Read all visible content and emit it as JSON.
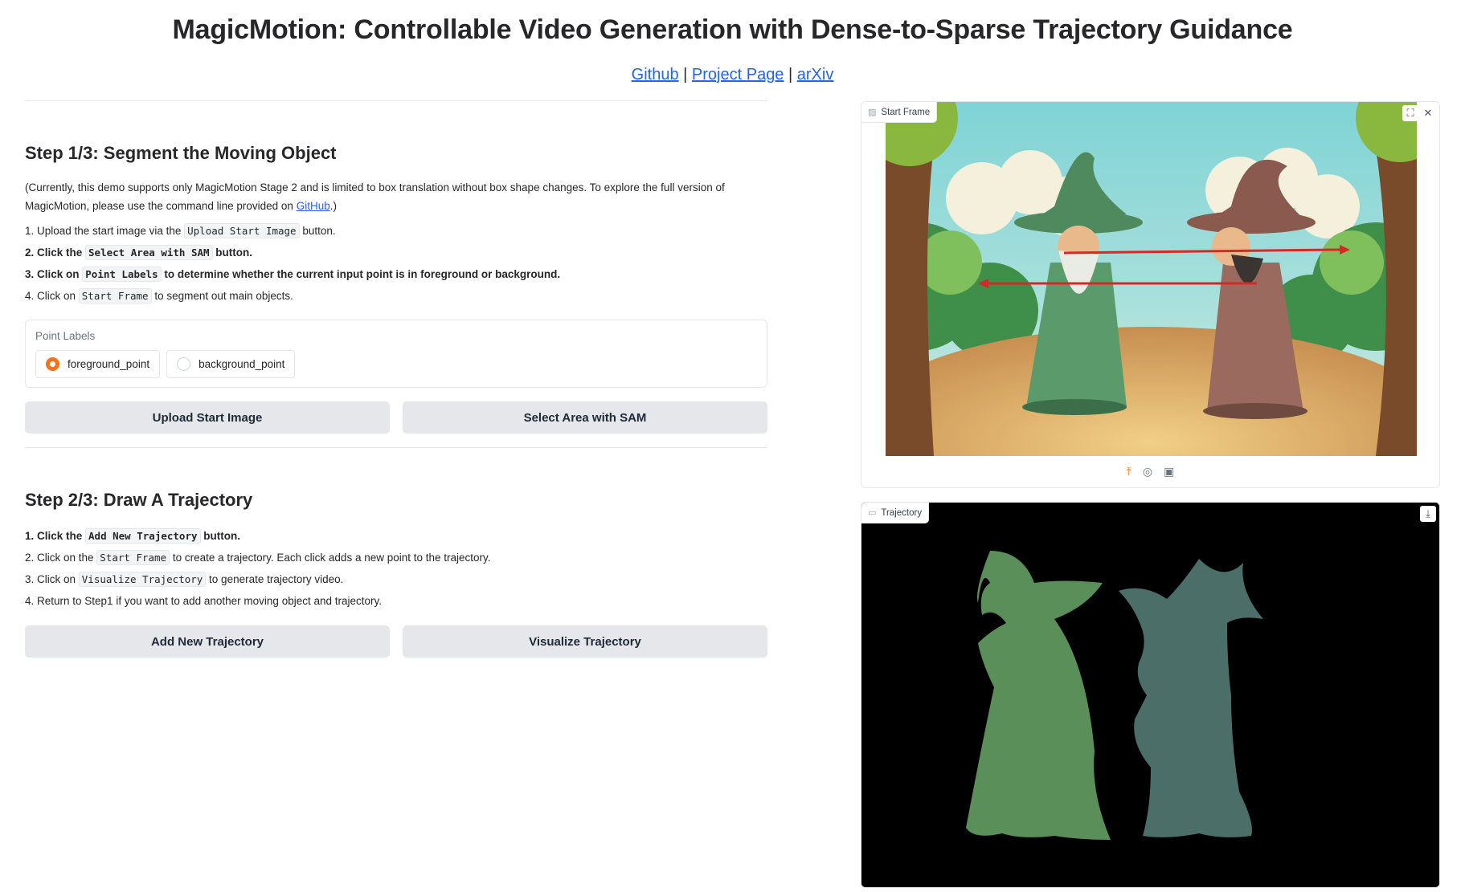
{
  "header": {
    "title": "MagicMotion: Controllable Video Generation with Dense-to-Sparse Trajectory Guidance",
    "links": {
      "github": "Github",
      "project": "Project Page",
      "arxiv": "arXiv",
      "sep": "|"
    }
  },
  "step1": {
    "title": "Step 1/3: Segment the Moving Object",
    "note_before": "(Currently, this demo supports only MagicMotion Stage 2 and is limited to box translation without box shape changes. To explore the full version of MagicMotion, please use the command line provided on ",
    "note_link": "GitHub",
    "note_after": ".)",
    "items": [
      {
        "n": "1. Upload the start image via the ",
        "code": "Upload Start Image",
        "rest": " button."
      },
      {
        "n": "2. Click the ",
        "code": "Select Area with SAM",
        "rest": " button."
      },
      {
        "n": "3. Click on ",
        "code": "Point Labels",
        "rest": " to determine whether the current input point is in foreground or background."
      },
      {
        "n": "4. Click on ",
        "code": "Start Frame",
        "rest": " to segment out main objects."
      }
    ],
    "radio": {
      "label": "Point Labels",
      "options": [
        "foreground_point",
        "background_point"
      ],
      "selected": "foreground_point"
    },
    "buttons": {
      "upload": "Upload Start Image",
      "sam": "Select Area with SAM"
    }
  },
  "step2": {
    "title": "Step 2/3: Draw A Trajectory",
    "items": [
      {
        "n": "1. Click the ",
        "code": "Add New Trajectory",
        "rest": " button."
      },
      {
        "n": "2. Click on the ",
        "code": "Start Frame",
        "rest": " to create a trajectory. Each click adds a new point to the trajectory."
      },
      {
        "n": "3. Click on ",
        "code": "Visualize Trajectory",
        "rest": " to generate trajectory video."
      },
      {
        "n": "4. Return to Step1 if you want to add another moving object and trajectory.",
        "code": "",
        "rest": ""
      }
    ],
    "buttons": {
      "add": "Add New Trajectory",
      "visualize": "Visualize Trajectory"
    }
  },
  "start_frame": {
    "label": "Start Frame",
    "fullscreen_icon": "⛶",
    "close_icon": "✕",
    "upload_icon": "⤒",
    "webcam_icon": "◎",
    "clipboard_icon": "▣"
  },
  "trajectory": {
    "label": "Trajectory",
    "download_icon": "⤓"
  },
  "colors": {
    "accent": "#f97316",
    "link": "#2563eb",
    "arrow": "#dc2626",
    "wizard_green_mask": "#5b8f5a",
    "wizard_teal_mask": "#4c6e68"
  }
}
